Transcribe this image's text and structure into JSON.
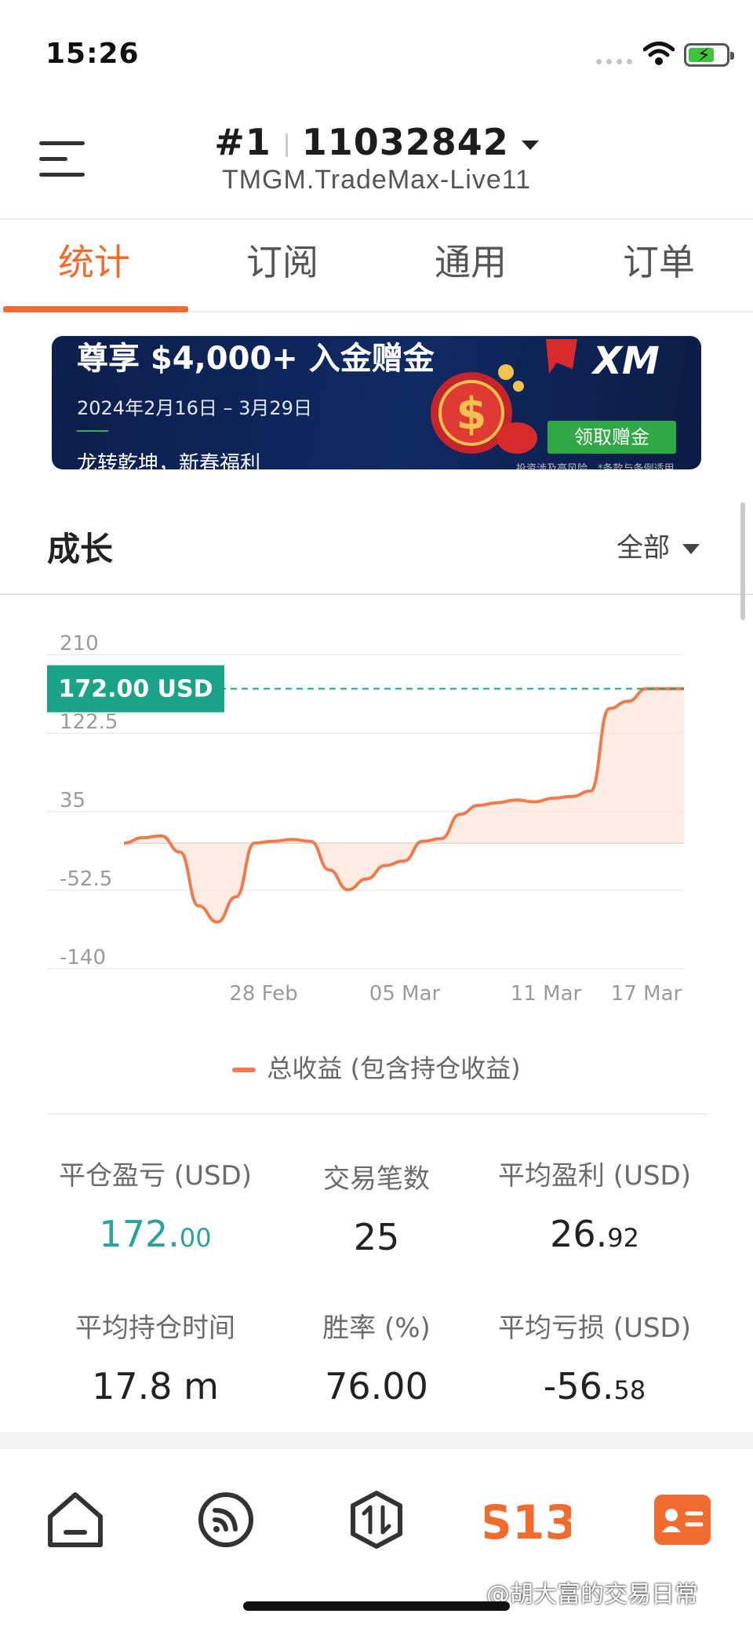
{
  "status_bar": {
    "time": "15:26"
  },
  "header": {
    "account_index": "#1",
    "account_number": "11032842",
    "server": "TMGM.TradeMax-Live11"
  },
  "tabs": [
    {
      "label": "统计",
      "active": true
    },
    {
      "label": "订阅",
      "active": false
    },
    {
      "label": "通用",
      "active": false
    },
    {
      "label": "订单",
      "active": false
    }
  ],
  "banner": {
    "title": "尊享 $4,000+ 入金赠金",
    "date": "2024年2月16日 – 3月29日",
    "slogan": "龙转乾坤，新春福利",
    "brand": "XM",
    "cta": "领取赠金",
    "disclaimer": "投资涉及高风险。*条款与条例适用。"
  },
  "growth": {
    "title": "成长",
    "range": "全部"
  },
  "chart_data": {
    "type": "area",
    "y_ticks": [
      "210",
      "122.5",
      "35",
      "-52.5",
      "-140"
    ],
    "ylim": [
      -140,
      210
    ],
    "x_tick_labels": [
      "28 Feb",
      "05 Mar",
      "11 Mar",
      "17 Mar"
    ],
    "current_value_label": "172.00 USD",
    "current_value": 172.0,
    "series": [
      {
        "name": "总收益 (包含持仓收益)",
        "values": [
          0,
          6,
          8,
          -10,
          -70,
          -88,
          -60,
          0,
          2,
          4,
          2,
          -30,
          -52,
          -40,
          -25,
          -20,
          2,
          5,
          32,
          42,
          45,
          48,
          46,
          50,
          52,
          58,
          150,
          158,
          172,
          172,
          172
        ]
      }
    ],
    "legend": "总收益 (包含持仓收益)",
    "colors": {
      "line": "#ef7a4d",
      "fill": "#fde4d8",
      "marker": "#1aa388"
    }
  },
  "stats": [
    {
      "label": "平仓盈亏 (USD)",
      "int": "172.",
      "dec": "00",
      "color": "#27a39a"
    },
    {
      "label": "交易笔数",
      "int": "25",
      "dec": ""
    },
    {
      "label": "平均盈利 (USD)",
      "int": "26.",
      "dec": "92"
    },
    {
      "label": "平均持仓时间",
      "int": "17.8 m",
      "dec": ""
    },
    {
      "label": "胜率 (%)",
      "int": "76.00",
      "dec": ""
    },
    {
      "label": "平均亏损 (USD)",
      "int": "-56.",
      "dec": "58"
    }
  ],
  "bottom_nav": {
    "items": [
      "home-icon",
      "feed-icon",
      "trade-icon",
      "s13-logo",
      "profile-icon"
    ],
    "logo_text": "S13"
  },
  "watermark": "@胡大富的交易日常"
}
